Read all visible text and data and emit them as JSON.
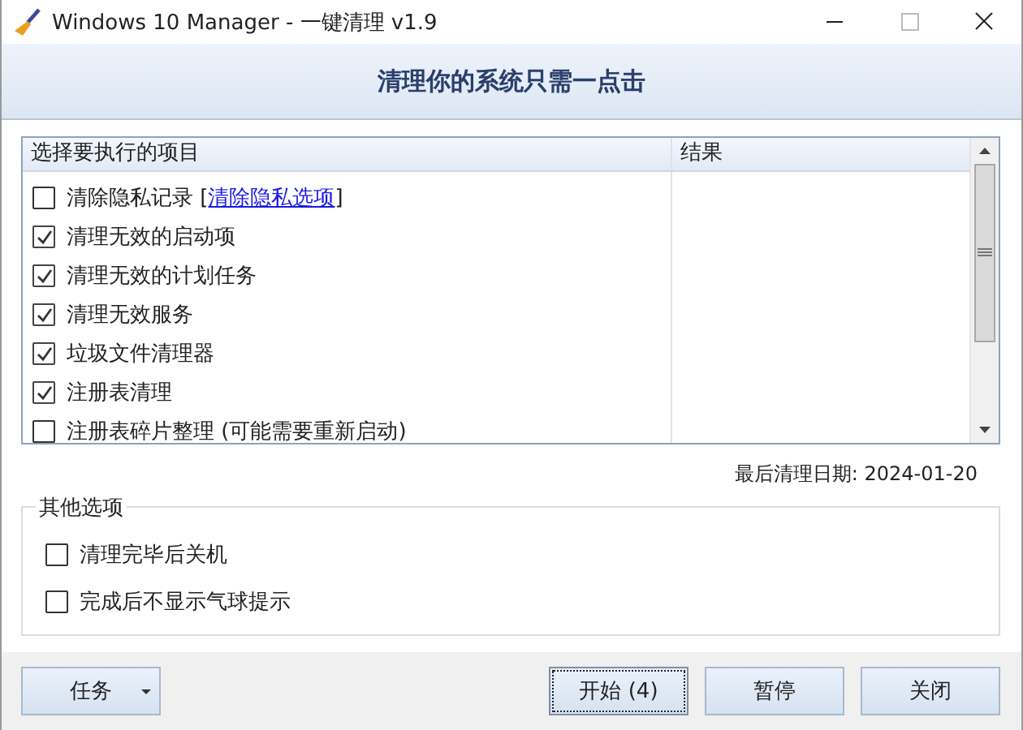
{
  "window": {
    "title": "Windows 10 Manager - 一键清理 v1.9"
  },
  "header": {
    "title": "清理你的系统只需一点击"
  },
  "list": {
    "columns": [
      "选择要执行的项目",
      "结果"
    ],
    "items": [
      {
        "label": "清除隐私记录 [",
        "link": "清除隐私选项",
        "suffix": "]",
        "checked": false
      },
      {
        "label": "清理无效的启动项",
        "checked": true
      },
      {
        "label": "清理无效的计划任务",
        "checked": true
      },
      {
        "label": "清理无效服务",
        "checked": true
      },
      {
        "label": "垃圾文件清理器",
        "checked": true
      },
      {
        "label": "注册表清理",
        "checked": true
      },
      {
        "label": "注册表碎片整理 (可能需要重新启动)",
        "checked": false
      }
    ]
  },
  "last_clean": "最后清理日期: 2024-01-20",
  "other_options": {
    "title": "其他选项",
    "items": [
      {
        "label": "清理完毕后关机",
        "checked": false
      },
      {
        "label": "完成后不显示气球提示",
        "checked": false
      }
    ]
  },
  "footer": {
    "task_button": "任务",
    "buttons": [
      {
        "label": "开始 (4)",
        "focused": true
      },
      {
        "label": "暂停",
        "focused": false
      },
      {
        "label": "关闭",
        "focused": false
      }
    ]
  }
}
